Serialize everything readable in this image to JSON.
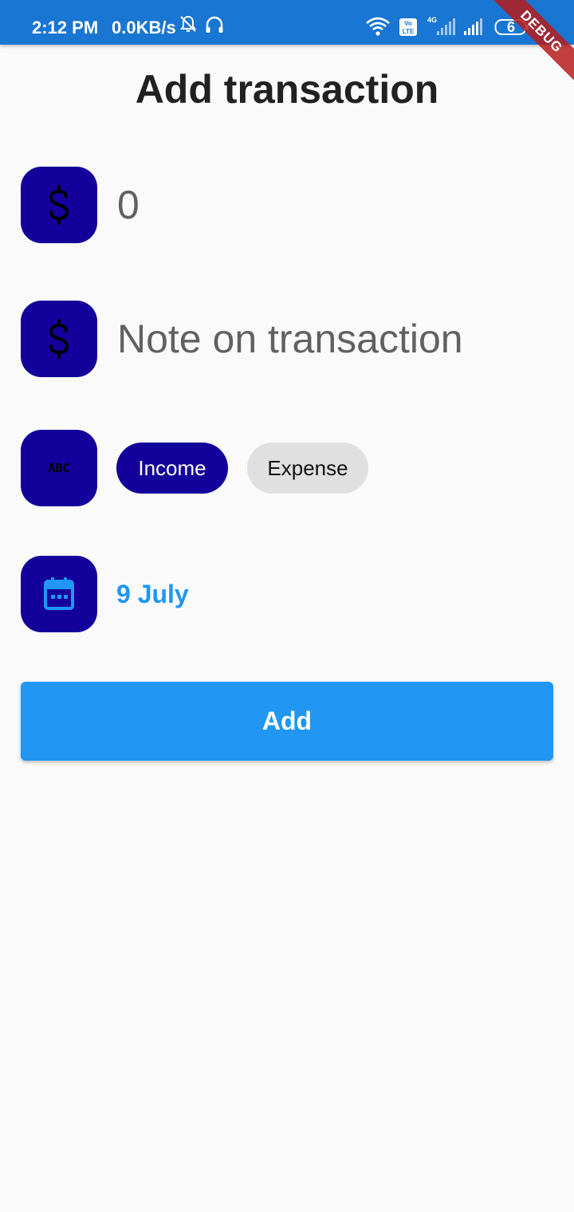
{
  "status_bar": {
    "time": "2:12 PM",
    "network_speed": "0.0KB/s",
    "battery": "6",
    "icons": [
      "bell-off-icon",
      "headphones-icon",
      "wifi-icon",
      "volte-icon",
      "signal-4g-icon",
      "signal-icon",
      "battery-icon"
    ],
    "color": "#1976d2"
  },
  "debug_banner": "DEBUG",
  "header": {
    "title": "Add transaction"
  },
  "form": {
    "amount": {
      "icon": "dollar-icon",
      "value": "0"
    },
    "note": {
      "icon": "dollar-icon",
      "placeholder": "Note on transaction"
    },
    "type": {
      "icon": "abc-icon",
      "options": [
        "Income",
        "Expense"
      ],
      "selected": "Income"
    },
    "date": {
      "icon": "calendar-icon",
      "value": "9 July"
    },
    "submit_label": "Add"
  },
  "colors": {
    "icon_box": "#14009a",
    "accent": "#2196f3",
    "chip_unselected": "#e0e0e0"
  }
}
